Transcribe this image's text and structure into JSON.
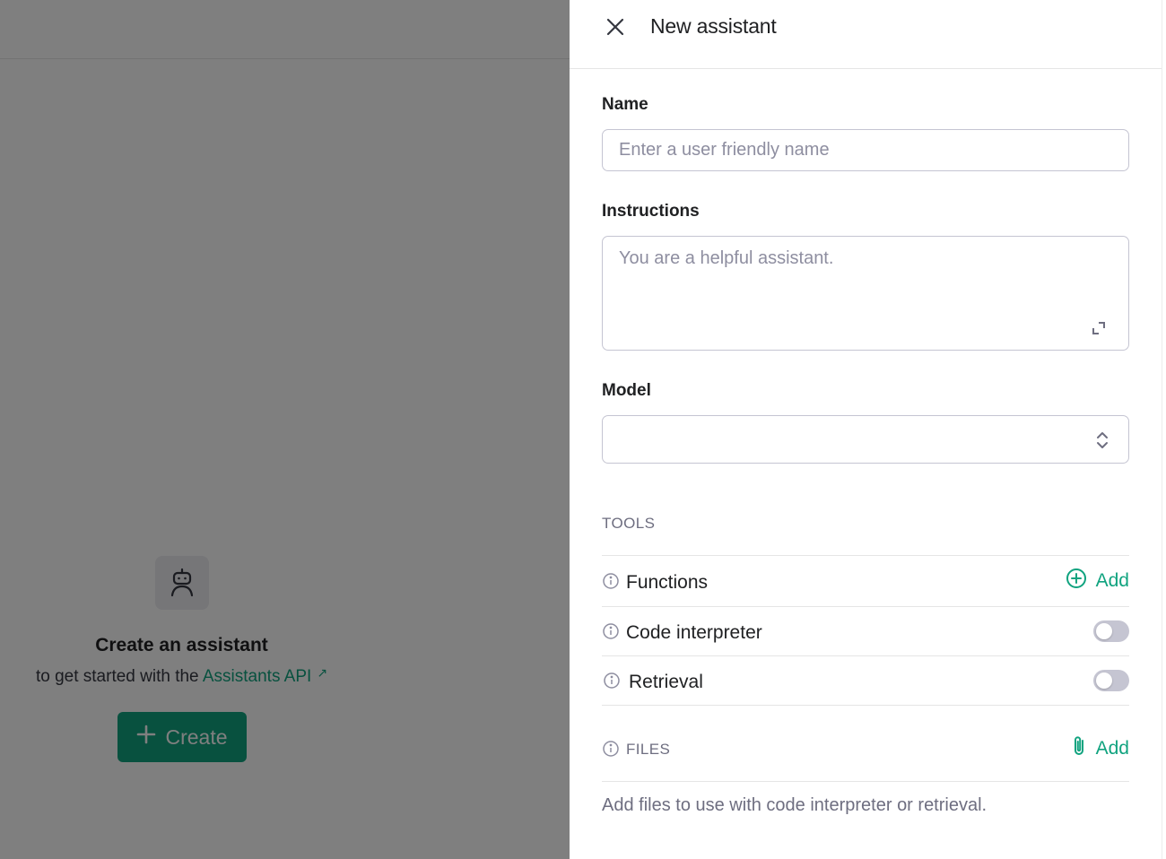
{
  "background": {
    "empty_state": {
      "icon": "robot-icon",
      "title": "Create an assistant",
      "subtitle_prefix": "to get started with the",
      "link_label": "Assistants API",
      "link_icon": "external-arrow-icon"
    },
    "create_button": {
      "label": "Create",
      "icon": "plus-icon"
    }
  },
  "drawer": {
    "title": "New assistant",
    "close_icon": "close-icon",
    "name": {
      "label": "Name",
      "value": "",
      "placeholder": "Enter a user friendly name"
    },
    "instructions": {
      "label": "Instructions",
      "value": "",
      "placeholder": "You are a helpful assistant.",
      "expand_icon": "expand-icon"
    },
    "model": {
      "label": "Model",
      "value": "",
      "icon": "chevron-up-down-icon"
    },
    "tools": {
      "heading": "TOOLS",
      "functions": {
        "label": "Functions",
        "action_label": "Add",
        "action_icon": "plus-circle-icon"
      },
      "code_interpreter": {
        "label": "Code interpreter",
        "enabled": false
      },
      "retrieval": {
        "label": "Retrieval",
        "enabled": false
      }
    },
    "files": {
      "heading": "FILES",
      "action_label": "Add",
      "action_icon": "paperclip-icon",
      "help_text": "Add files to use with code interpreter or retrieval."
    }
  },
  "colors": {
    "accent": "#10a37f",
    "overlay": "rgba(0,0,0,0.5)",
    "toggle_off": "#c5c5d2",
    "muted_text": "#6e6e80",
    "border": "#c5c5d2"
  }
}
